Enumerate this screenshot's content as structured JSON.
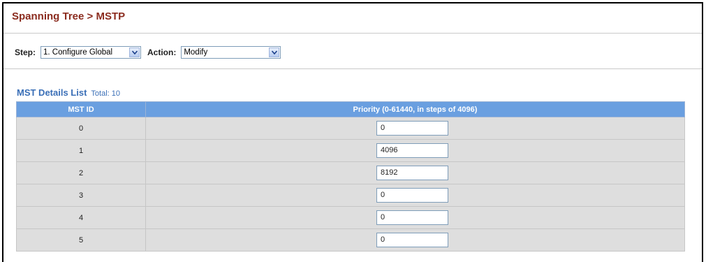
{
  "breadcrumb": "Spanning Tree > MSTP",
  "toolbar": {
    "step_label": "Step:",
    "step_value": "1. Configure Global",
    "action_label": "Action:",
    "action_value": "Modify"
  },
  "list": {
    "title": "MST Details List",
    "total": "Total: 10"
  },
  "table": {
    "headers": [
      "MST ID",
      "Priority (0-61440, in steps of 4096)"
    ],
    "rows": [
      {
        "mst_id": "0",
        "priority": "0"
      },
      {
        "mst_id": "1",
        "priority": "4096"
      },
      {
        "mst_id": "2",
        "priority": "8192"
      },
      {
        "mst_id": "3",
        "priority": "0"
      },
      {
        "mst_id": "4",
        "priority": "0"
      },
      {
        "mst_id": "5",
        "priority": "0"
      }
    ]
  },
  "colors": {
    "title": "#8b2c1f",
    "header_bg": "#6a9fe0",
    "row_bg": "#dedede",
    "accent_text": "#3a6fb7"
  },
  "icons": [
    "chevron-down-icon"
  ]
}
